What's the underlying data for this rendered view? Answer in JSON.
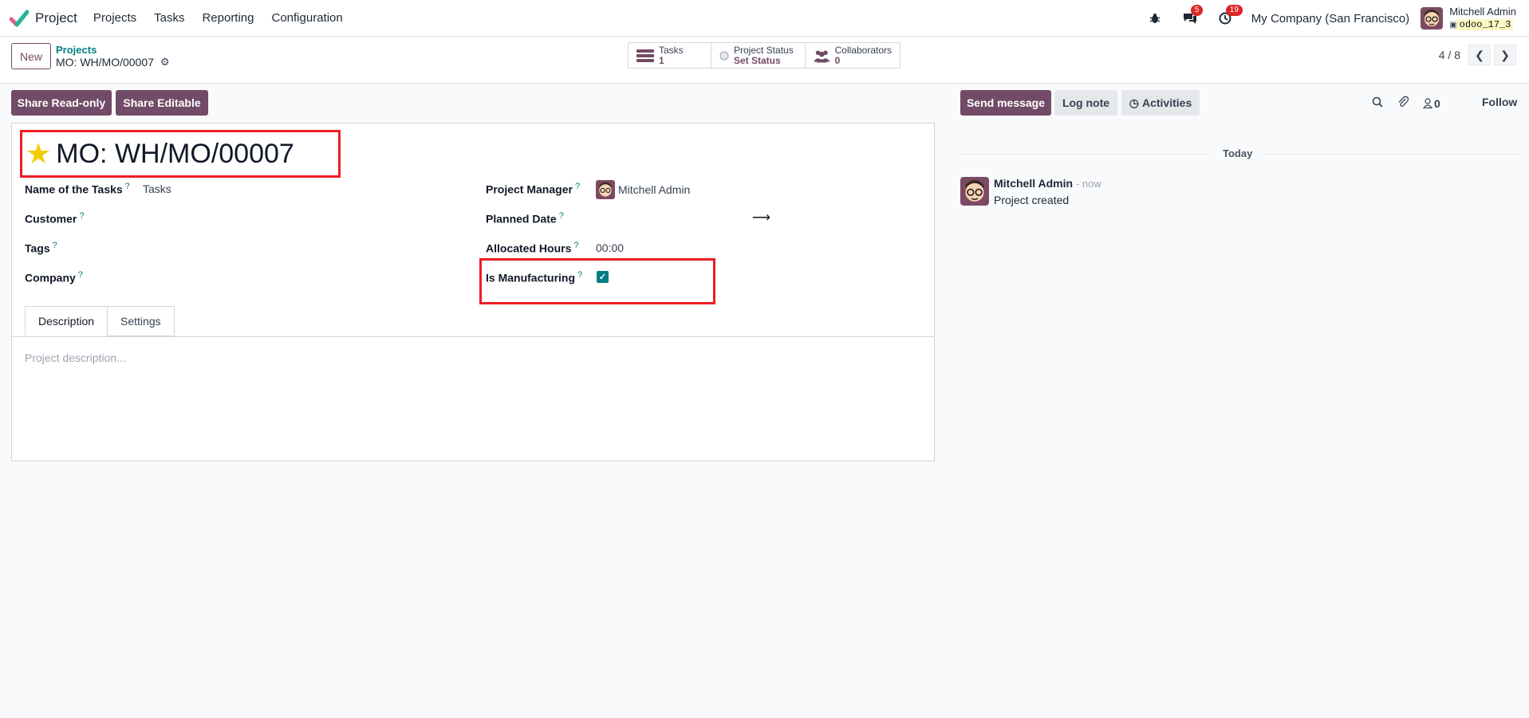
{
  "navbar": {
    "app_name": "Project",
    "menu": [
      "Projects",
      "Tasks",
      "Reporting",
      "Configuration"
    ],
    "messages_count": "5",
    "activities_count": "19",
    "company": "My Company (San Francisco)",
    "user_name": "Mitchell Admin",
    "db_name": "odoo_17_3"
  },
  "control": {
    "new_label": "New",
    "breadcrumb_parent": "Projects",
    "breadcrumb_current": "MO: WH/MO/00007",
    "smart_buttons": [
      {
        "label": "Tasks",
        "value": "1",
        "icon": "tasks-icon"
      },
      {
        "label": "Project Status",
        "value": "Set Status",
        "icon": "status-circle-icon"
      },
      {
        "label": "Collaborators",
        "value": "0",
        "icon": "users-icon"
      }
    ],
    "pager": "4 / 8"
  },
  "actions": {
    "share_readonly": "Share Read-only",
    "share_editable": "Share Editable"
  },
  "form": {
    "title": "MO: WH/MO/00007",
    "fields": {
      "name_of_tasks_label": "Name of the Tasks",
      "name_of_tasks_value": "Tasks",
      "customer_label": "Customer",
      "tags_label": "Tags",
      "company_label": "Company",
      "project_manager_label": "Project Manager",
      "project_manager_value": "Mitchell Admin",
      "planned_date_label": "Planned Date",
      "allocated_hours_label": "Allocated Hours",
      "allocated_hours_value": "00:00",
      "is_manufacturing_label": "Is Manufacturing",
      "is_manufacturing_checked": true,
      "help_mark": "?"
    },
    "tabs": [
      "Description",
      "Settings"
    ],
    "description_placeholder": "Project description..."
  },
  "chatter": {
    "send_message": "Send message",
    "log_note": "Log note",
    "activities": "Activities",
    "followers_count": "0",
    "follow": "Follow",
    "date_separator": "Today",
    "message": {
      "author": "Mitchell Admin",
      "time": "- now",
      "body": "Project created"
    }
  },
  "colors": {
    "primary": "#714b67",
    "teal": "#017e84",
    "highlight": "#ef1c25",
    "star": "#f3cc00"
  }
}
